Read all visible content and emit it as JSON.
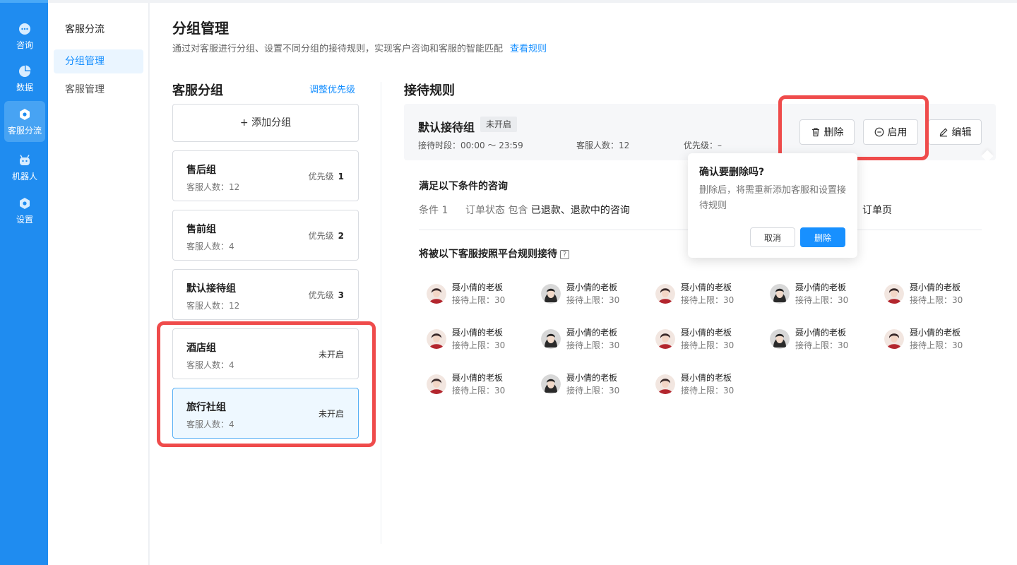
{
  "nav": {
    "items": [
      {
        "label": "咨询",
        "icon": "chat-bubble-icon"
      },
      {
        "label": "数据",
        "icon": "pie-chart-icon"
      },
      {
        "label": "客服分流",
        "icon": "routing-icon"
      },
      {
        "label": "机器人",
        "icon": "robot-icon"
      },
      {
        "label": "设置",
        "icon": "gear-icon"
      }
    ]
  },
  "subnav": {
    "title": "客服分流",
    "items": [
      {
        "label": "分组管理"
      },
      {
        "label": "客服管理"
      }
    ]
  },
  "page": {
    "title": "分组管理",
    "desc": "通过对客服进行分组、设置不同分组的接待规则，实现客户咨询和客服的智能匹配",
    "rule_link": "查看规则"
  },
  "groups": {
    "title": "客服分组",
    "adjust": "调整优先级",
    "add": "+ 添加分组",
    "items": [
      {
        "name": "售后组",
        "count": "客服人数：12",
        "prio_label": "优先级",
        "prio": "1"
      },
      {
        "name": "售前组",
        "count": "客服人数：4",
        "prio_label": "优先级",
        "prio": "2"
      },
      {
        "name": "默认接待组",
        "count": "客服人数：12",
        "prio_label": "优先级",
        "prio": "3"
      },
      {
        "name": "酒店组",
        "count": "客服人数：4",
        "status": "未开启"
      },
      {
        "name": "旅行社组",
        "count": "客服人数：4",
        "status": "未开启"
      }
    ]
  },
  "rules": {
    "title": "接待规则",
    "group_name": "默认接待组",
    "badge": "未开启",
    "time": "接待时段：00:00 ～ 23:59",
    "count": "客服人数：12",
    "priority": "优先级：–",
    "btn_delete": "删除",
    "btn_enable": "启用",
    "btn_edit": "编辑",
    "cond_title": "满足以下条件的咨询",
    "cond_label": "条件 1",
    "cond_prefix": "订单状态 包含",
    "cond_value": "已退款、退款中的咨询",
    "cond_tail": "订单页",
    "agents_title": "将被以下客服按照平台规则接待",
    "help": "?",
    "agents": [
      {
        "name": "聂小倩的老板",
        "limit": "接待上限：30"
      },
      {
        "name": "聂小倩的老板",
        "limit": "接待上限：30"
      },
      {
        "name": "聂小倩的老板",
        "limit": "接待上限：30"
      },
      {
        "name": "聂小倩的老板",
        "limit": "接待上限：30"
      },
      {
        "name": "聂小倩的老板",
        "limit": "接待上限：30"
      },
      {
        "name": "聂小倩的老板",
        "limit": "接待上限：30"
      },
      {
        "name": "聂小倩的老板",
        "limit": "接待上限：30"
      },
      {
        "name": "聂小倩的老板",
        "limit": "接待上限：30"
      },
      {
        "name": "聂小倩的老板",
        "limit": "接待上限：30"
      },
      {
        "name": "聂小倩的老板",
        "limit": "接待上限：30"
      },
      {
        "name": "聂小倩的老板",
        "limit": "接待上限：30"
      },
      {
        "name": "聂小倩的老板",
        "limit": "接待上限：30"
      },
      {
        "name": "聂小倩的老板",
        "limit": "接待上限：30"
      }
    ]
  },
  "popconfirm": {
    "title": "确认要删除吗?",
    "content": "删除后，将需重新添加客服和设置接待规则",
    "cancel": "取消",
    "ok": "删除"
  },
  "colors": {
    "primary": "#1890ff",
    "nav_bg": "#1f8cf0",
    "highlight": "#ef4b4b"
  }
}
